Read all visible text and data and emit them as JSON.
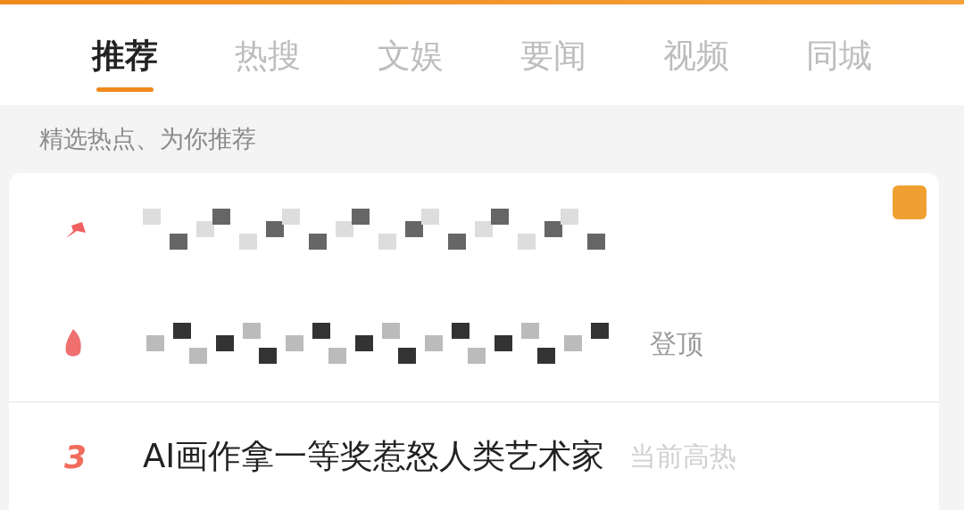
{
  "tabs": [
    {
      "label": "推荐",
      "selected": true
    },
    {
      "label": "热搜",
      "selected": false
    },
    {
      "label": "文娱",
      "selected": false
    },
    {
      "label": "要闻",
      "selected": false
    },
    {
      "label": "视频",
      "selected": false
    },
    {
      "label": "同城",
      "selected": false
    }
  ],
  "subtitle": "精选热点、为你推荐",
  "rows": [
    {
      "kind": "pinned",
      "title_hidden": true,
      "badge": true
    },
    {
      "kind": "top",
      "title_hidden": true,
      "tag": "登顶"
    },
    {
      "kind": "rank",
      "rank": "3",
      "title": "AI画作拿一等奖惹怒人类艺术家",
      "tag": "当前高热"
    }
  ]
}
